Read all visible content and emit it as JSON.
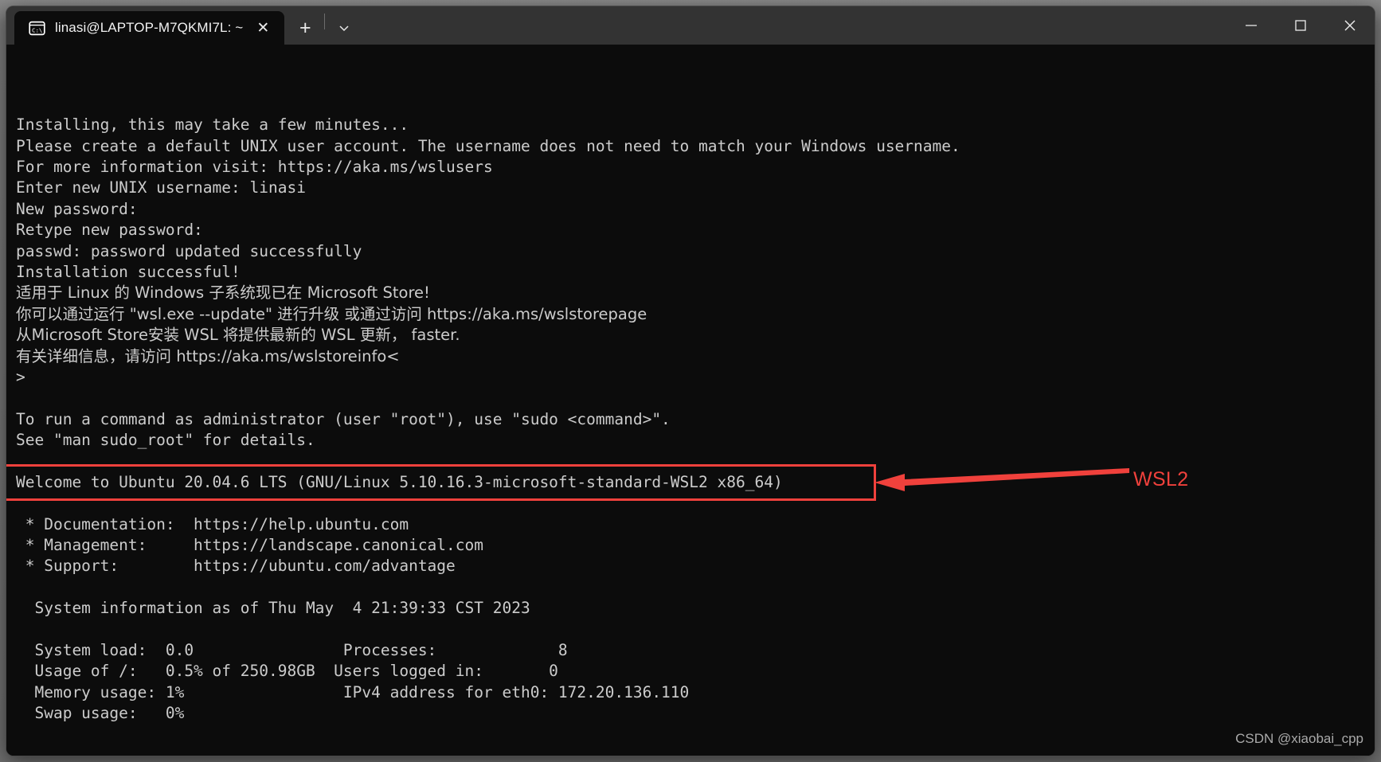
{
  "window": {
    "tab": {
      "icon": "console-cmd-icon",
      "title": "linasi@LAPTOP-M7QKMI7L: ~",
      "close_label": "✕"
    },
    "new_tab_label": "+",
    "tab_menu_icon": "chevron-down-icon",
    "controls": {
      "minimize": "minimize-icon",
      "maximize": "maximize-icon",
      "close": "close-icon"
    }
  },
  "terminal": {
    "lines": [
      {
        "text": "Installing, this may take a few minutes...",
        "cjk": false
      },
      {
        "text": "Please create a default UNIX user account. The username does not need to match your Windows username.",
        "cjk": false
      },
      {
        "text": "For more information visit: https://aka.ms/wslusers",
        "cjk": false
      },
      {
        "text": "Enter new UNIX username: linasi",
        "cjk": false
      },
      {
        "text": "New password:",
        "cjk": false
      },
      {
        "text": "Retype new password:",
        "cjk": false
      },
      {
        "text": "passwd: password updated successfully",
        "cjk": false
      },
      {
        "text": "Installation successful!",
        "cjk": false
      },
      {
        "text": "适用于 Linux 的 Windows 子系统现已在 Microsoft Store!",
        "cjk": true
      },
      {
        "text": "你可以通过运行 \"wsl.exe --update\" 进行升级 或通过访问 https://aka.ms/wslstorepage",
        "cjk": true
      },
      {
        "text": "从Microsoft Store安装 WSL 将提供最新的 WSL 更新， faster.",
        "cjk": true
      },
      {
        "text": "有关详细信息，请访问 https://aka.ms/wslstoreinfo<",
        "cjk": true
      },
      {
        "text": ">",
        "cjk": false
      },
      {
        "text": "",
        "cjk": false
      },
      {
        "text": "To run a command as administrator (user \"root\"), use \"sudo <command>\".",
        "cjk": false
      },
      {
        "text": "See \"man sudo_root\" for details.",
        "cjk": false
      },
      {
        "text": "",
        "cjk": false
      },
      {
        "text": "Welcome to Ubuntu 20.04.6 LTS (GNU/Linux 5.10.16.3-microsoft-standard-WSL2 x86_64)",
        "cjk": false
      },
      {
        "text": "",
        "cjk": false
      },
      {
        "text": " * Documentation:  https://help.ubuntu.com",
        "cjk": false
      },
      {
        "text": " * Management:     https://landscape.canonical.com",
        "cjk": false
      },
      {
        "text": " * Support:        https://ubuntu.com/advantage",
        "cjk": false
      },
      {
        "text": "",
        "cjk": false
      },
      {
        "text": "  System information as of Thu May  4 21:39:33 CST 2023",
        "cjk": false
      },
      {
        "text": "",
        "cjk": false
      },
      {
        "text": "  System load:  0.0                Processes:             8",
        "cjk": false
      },
      {
        "text": "  Usage of /:   0.5% of 250.98GB  Users logged in:       0",
        "cjk": false
      },
      {
        "text": "  Memory usage: 1%                 IPv4 address for eth0: 172.20.136.110",
        "cjk": false
      },
      {
        "text": "  Swap usage:   0%",
        "cjk": false
      }
    ]
  },
  "annotation": {
    "label": "WSL2",
    "color": "#f0413c",
    "highlighted_line": "Welcome to Ubuntu 20.04.6 LTS (GNU/Linux 5.10.16.3-microsoft-standard-WSL2 x86_64)"
  },
  "watermark": {
    "text": "CSDN @xiaobai_cpp"
  }
}
